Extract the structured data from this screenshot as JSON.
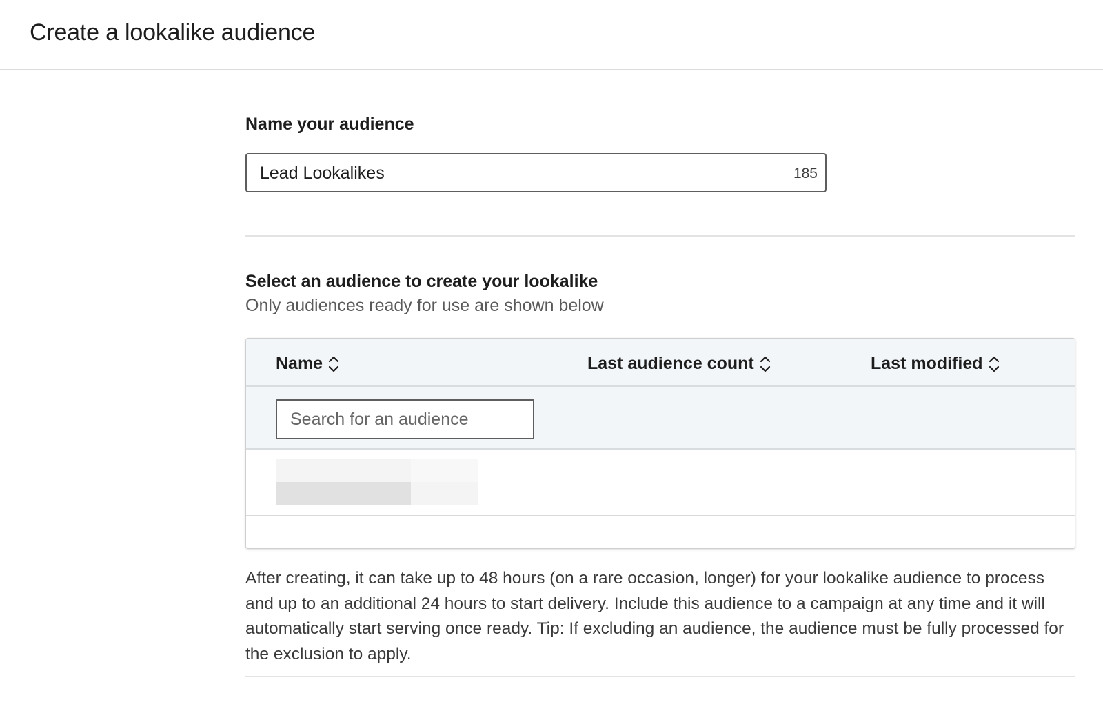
{
  "page": {
    "title": "Create a lookalike audience"
  },
  "name_section": {
    "label": "Name your audience",
    "value": "Lead Lookalikes",
    "char_counter": "185"
  },
  "select_section": {
    "title": "Select an audience to create your lookalike",
    "subtitle": "Only audiences ready for use are shown below"
  },
  "table": {
    "columns": [
      "Name",
      "Last audience count",
      "Last modified"
    ],
    "search_placeholder": "Search for an audience",
    "rows_loading": true
  },
  "footer": {
    "note": "After creating, it can take up to 48 hours (on a rare occasion, longer) for your lookalike audience to process and up to an additional 24 hours to start delivery. Include this audience to a campaign at any time and it will automatically start serving once ready. Tip: If excluding an audience, the audience must be fully processed for the exclusion to apply."
  },
  "icons": {
    "sort": "sort-chevrons-icon"
  }
}
